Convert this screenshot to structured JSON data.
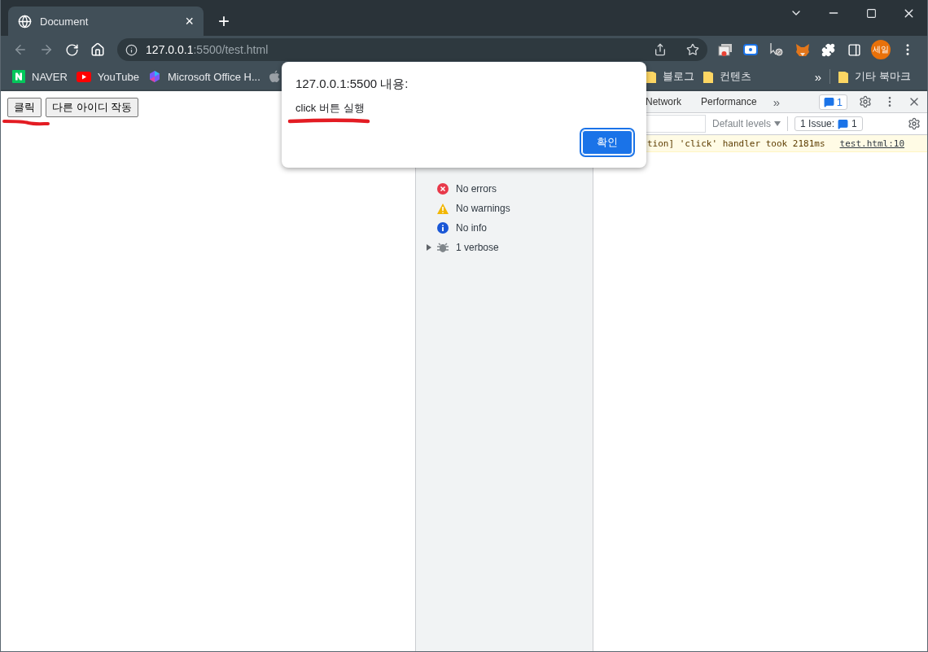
{
  "tab": {
    "title": "Document",
    "close": "×"
  },
  "new_tab": "+",
  "address_bar": {
    "host": "127.0.0.1",
    "path": ":5500/test.html"
  },
  "profile": {
    "initials": "세일"
  },
  "bookmarks_left": [
    {
      "kind": "naver",
      "label": "NAVER"
    },
    {
      "kind": "youtube",
      "label": "YouTube"
    },
    {
      "kind": "office",
      "label": "Microsoft Office H..."
    },
    {
      "kind": "apple"
    }
  ],
  "bookmarks_right": [
    {
      "kind": "folder",
      "label": "블로그"
    },
    {
      "kind": "folder",
      "label": "컨텐츠"
    }
  ],
  "bookmarks_more": "»",
  "other_bookmarks": "기타 북마크",
  "page": {
    "buttons": [
      "클릭",
      "다른 아이디 작동"
    ]
  },
  "dialog": {
    "title": "127.0.0.1:5500 내용:",
    "message": "click 버튼 실행",
    "ok": "확인"
  },
  "devtools": {
    "tabs": [
      {
        "label": "Network"
      },
      {
        "label": "Performance"
      }
    ],
    "more_tabs": "»",
    "issues_badge": "1",
    "levels": "Default levels",
    "issues_button": {
      "label": "1 Issue:",
      "count": "1"
    },
    "sidebar": [
      {
        "kind": "errors",
        "label": "No errors"
      },
      {
        "kind": "warnings",
        "label": "No warnings"
      },
      {
        "kind": "info",
        "label": "No info"
      },
      {
        "kind": "verbose",
        "label": "1 verbose"
      }
    ],
    "console": [
      {
        "kind": "violation",
        "text": "tion] 'click' handler took 2181ms",
        "source": "test.html:10"
      }
    ]
  }
}
